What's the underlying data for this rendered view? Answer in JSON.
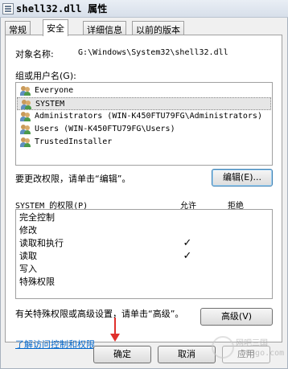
{
  "window": {
    "title": "shell32.dll 属性"
  },
  "tabs": [
    {
      "label": "常规"
    },
    {
      "label": "安全"
    },
    {
      "label": "详细信息"
    },
    {
      "label": "以前的版本"
    }
  ],
  "security": {
    "object_label": "对象名称:",
    "object_value": "G:\\Windows\\System32\\shell32.dll",
    "group_label": "组或用户名(G):",
    "users": [
      {
        "name": "Everyone"
      },
      {
        "name": "SYSTEM"
      },
      {
        "name": "Administrators (WIN-K450FTU79FG\\Administrators)"
      },
      {
        "name": "Users (WIN-K450FTU79FG\\Users)"
      },
      {
        "name": "TrustedInstaller"
      }
    ],
    "change_text": "要更改权限，请单击“编辑”。",
    "edit_button": "编辑(E)...",
    "perm_header": "SYSTEM 的权限(P)",
    "allow_header": "允许",
    "deny_header": "拒绝",
    "permissions": [
      {
        "name": "完全控制",
        "allow": "",
        "deny": ""
      },
      {
        "name": "修改",
        "allow": "",
        "deny": ""
      },
      {
        "name": "读取和执行",
        "allow": "✓",
        "deny": ""
      },
      {
        "name": "读取",
        "allow": "✓",
        "deny": ""
      },
      {
        "name": "写入",
        "allow": "",
        "deny": ""
      },
      {
        "name": "特殊权限",
        "allow": "",
        "deny": ""
      }
    ],
    "advanced_text": "有关特殊权限或高级设置，请单击“高级”。",
    "advanced_button": "高级(V)",
    "learn_link": "了解访问控制和权限"
  },
  "footer": {
    "ok": "确定",
    "cancel": "取消",
    "apply": "应用"
  },
  "watermark": {
    "line1": "网吧三国",
    "line2": "583go.com"
  },
  "colors": {
    "link": "#0066cc",
    "arrow": "#e0302c",
    "selection": "#e6e6e6"
  },
  "icons": {
    "title": "file-properties-icon",
    "user": "users-group-icon"
  }
}
